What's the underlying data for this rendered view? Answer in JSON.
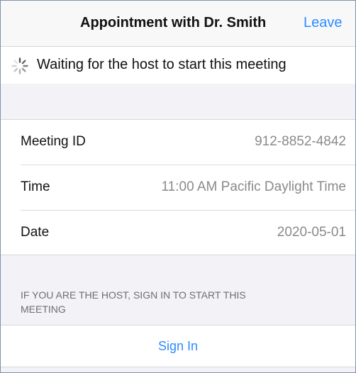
{
  "header": {
    "title": "Appointment with Dr. Smith",
    "leave_label": "Leave"
  },
  "status": {
    "text": "Waiting for the host to start this meeting",
    "icon": "loading-spinner-icon"
  },
  "meeting_info": {
    "rows": [
      {
        "label": "Meeting ID",
        "value": "912-8852-4842"
      },
      {
        "label": "Time",
        "value": "11:00 AM Pacific Daylight Time"
      },
      {
        "label": "Date",
        "value": "2020-05-01"
      }
    ]
  },
  "host_note": "IF YOU ARE THE HOST, SIGN IN TO START THIS MEETING",
  "sign_in_label": "Sign In",
  "colors": {
    "accent": "#2d8cff",
    "background": "#f2f2f7",
    "secondary_text": "#8a8a8e"
  }
}
